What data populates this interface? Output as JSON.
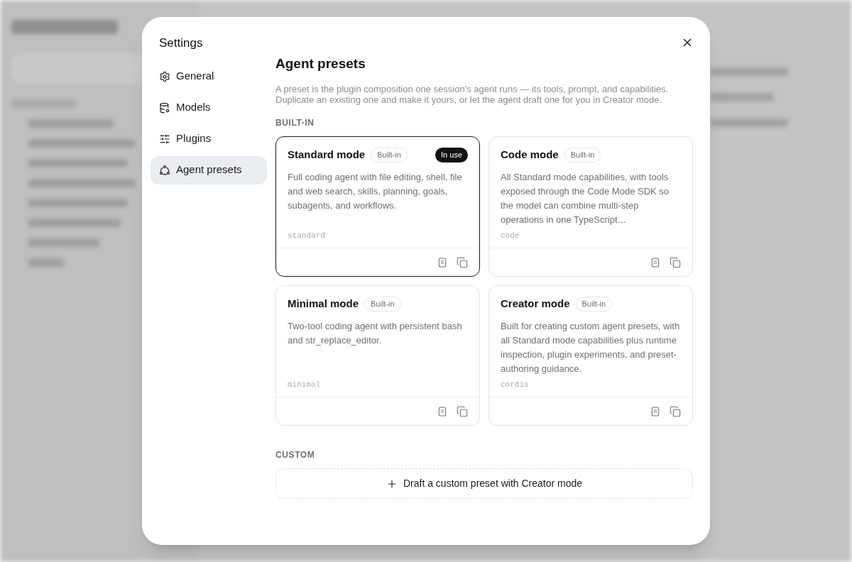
{
  "dialog": {
    "title": "Settings",
    "nav": [
      {
        "label": "General",
        "selected": false
      },
      {
        "label": "Models",
        "selected": false
      },
      {
        "label": "Plugins",
        "selected": false
      },
      {
        "label": "Agent presets",
        "selected": true
      }
    ]
  },
  "page": {
    "heading": "Agent presets",
    "description": "A preset is the plugin composition one session's agent runs — its tools, prompt, and capabilities. Duplicate an existing one and make it yours, or let the agent draft one for you in Creator mode.",
    "builtin_label": "BUILT-IN",
    "presets": [
      {
        "name": "Standard mode",
        "selected": true,
        "badges": [
          {
            "label": "Built-in",
            "kind": "outline"
          },
          {
            "label": "In use",
            "kind": "solid"
          }
        ],
        "description": "Full coding agent with file editing, shell, file and web search, skills, planning, goals, subagents, and workflows.",
        "slug": "standard"
      },
      {
        "name": "Code mode",
        "selected": false,
        "badges": [
          {
            "label": "Built-in",
            "kind": "outline"
          }
        ],
        "description": "All Standard mode capabilities, with tools exposed through the Code Mode SDK so the model can combine multi-step operations in one TypeScript…",
        "slug": "code"
      },
      {
        "name": "Minimal mode",
        "selected": false,
        "badges": [
          {
            "label": "Built-in",
            "kind": "outline"
          }
        ],
        "description": "Two-tool coding agent with persistent bash and str_replace_editor.",
        "slug": "minimal"
      },
      {
        "name": "Creator mode",
        "selected": false,
        "badges": [
          {
            "label": "Built-in",
            "kind": "outline"
          }
        ],
        "description": "Built for creating custom agent presets, with all Standard mode capabilities plus runtime inspection, plugin experiments, and preset-authoring guidance.",
        "slug": "cordis"
      }
    ],
    "custom_label": "CUSTOM",
    "draft_button": "Draft a custom preset with Creator mode"
  }
}
